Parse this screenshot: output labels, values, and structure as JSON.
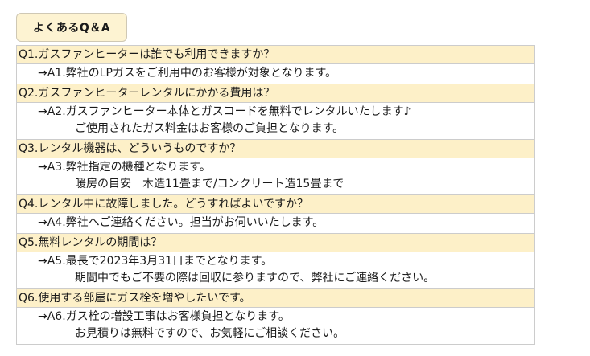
{
  "faq": {
    "title": "よくあるQ＆A",
    "items": [
      {
        "question": "Q1.ガスファンヒーターは誰でも利用できますか？",
        "answer": [
          "→A1.弊社のLPガスをご利用中のお客様が対象となります。"
        ]
      },
      {
        "question": "Q2.ガスファンヒーターレンタルにかかる費用は？",
        "answer": [
          "→A2.ガスファンヒーター本体とガスコードを無料でレンタルいたします♪",
          "ご使用されたガス料金はお客様のご負担となります。"
        ]
      },
      {
        "question": "Q3.レンタル機器は、どういうものですか？",
        "answer": [
          "→A3.弊社指定の機種となります。",
          "暖房の目安　木造11畳まで/コンクリート造15畳まで"
        ]
      },
      {
        "question": "Q4.レンタル中に故障しました。どうすればよいですか？",
        "answer": [
          "→A4.弊社へご連絡ください。担当がお伺いいたします。"
        ]
      },
      {
        "question": "Q5.無料レンタルの期間は？",
        "answer": [
          "→A5.最長で2023年3月31日までとなります。",
          "期間中でもご不要の際は回収に参りますので、弊社にご連絡ください。"
        ]
      },
      {
        "question": "Q6.使用する部屋にガス栓を増やしたいです。",
        "answer": [
          "→A6.ガス栓の増設工事はお客様負担となります。",
          "お見積りは無料ですので、お気軽にご相談ください。"
        ]
      }
    ]
  }
}
